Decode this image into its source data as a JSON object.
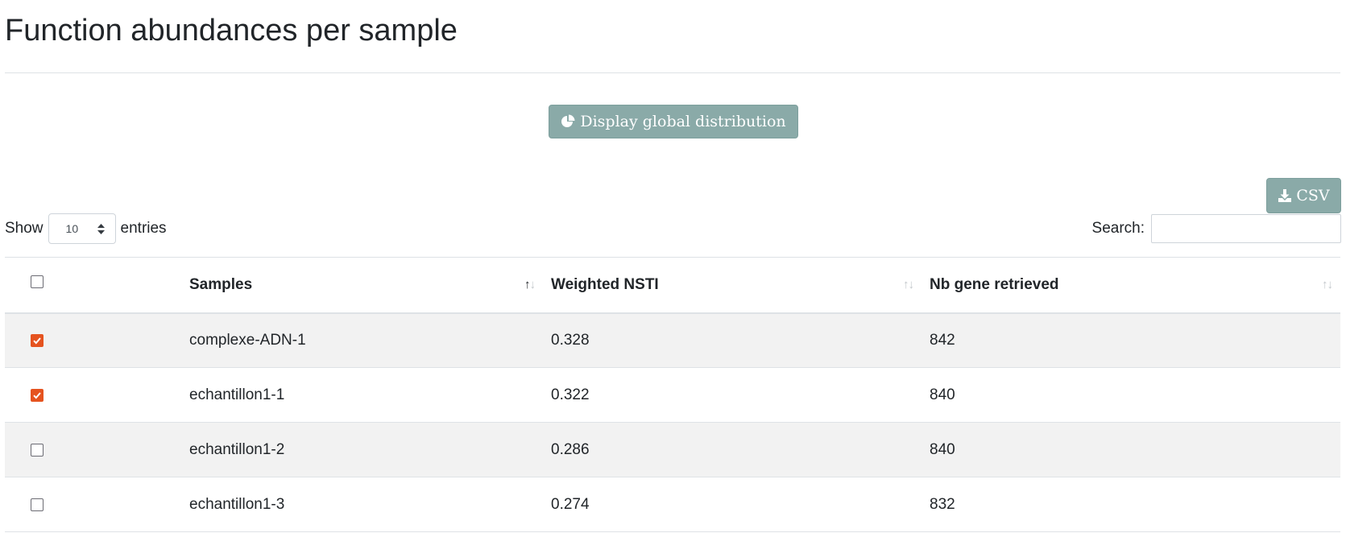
{
  "header": {
    "title": "Function abundances per sample"
  },
  "actions": {
    "global_distribution_label": "Display global distribution",
    "csv_label": "CSV"
  },
  "table_controls": {
    "show_label": "Show",
    "page_length": "10",
    "entries_label": "entries",
    "search_label": "Search:",
    "search_value": ""
  },
  "table": {
    "columns": [
      "Samples",
      "Weighted NSTI",
      "Nb gene retrieved"
    ],
    "rows": [
      {
        "checked": true,
        "sample": "complexe-ADN-1",
        "nsti": "0.328",
        "genes": "842"
      },
      {
        "checked": true,
        "sample": "echantillon1-1",
        "nsti": "0.322",
        "genes": "840"
      },
      {
        "checked": false,
        "sample": "echantillon1-2",
        "nsti": "0.286",
        "genes": "840"
      },
      {
        "checked": false,
        "sample": "echantillon1-3",
        "nsti": "0.274",
        "genes": "832"
      }
    ]
  },
  "icons": {
    "global_distribution": "pie-chart-icon",
    "csv": "download-icon",
    "sort": "sort-icon"
  },
  "colors": {
    "button_bg": "#8aaaa8",
    "checkbox_checked": "#e5531f",
    "striped_row": "#f2f2f2"
  }
}
